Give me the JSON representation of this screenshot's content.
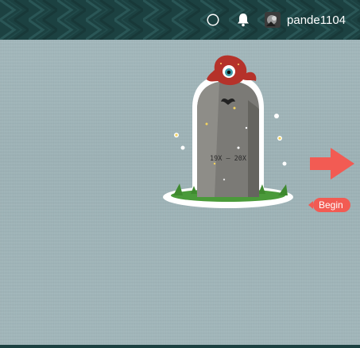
{
  "header": {
    "username": "pande1104",
    "icons": {
      "status": "compass-icon",
      "notifications": "bell-icon",
      "avatar": "avatar"
    }
  },
  "illustration": {
    "tombstone_text": "19X — 20X"
  },
  "navigation": {
    "next": "arrow-right-icon",
    "begin_label": "Begin"
  },
  "colors": {
    "topbar": "#1c4141",
    "background": "#a2b7bb",
    "accent": "#f25b53"
  }
}
